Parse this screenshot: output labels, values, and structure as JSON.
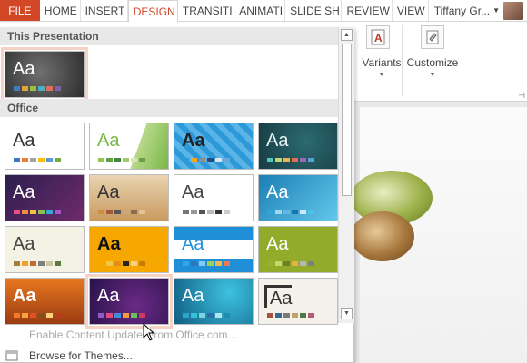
{
  "tabs": [
    {
      "label": "FILE"
    },
    {
      "label": "HOME"
    },
    {
      "label": "INSERT"
    },
    {
      "label": "DESIGN"
    },
    {
      "label": "TRANSITI"
    },
    {
      "label": "ANIMATI"
    },
    {
      "label": "SLIDE SH"
    },
    {
      "label": "REVIEW"
    },
    {
      "label": "VIEW"
    }
  ],
  "user": {
    "name": "Tiffany Gr..."
  },
  "ribbon": {
    "variants_label": "Variants",
    "customize_label": "Customize"
  },
  "gallery": {
    "this_presentation_header": "This Presentation",
    "office_header": "Office",
    "current_theme": {
      "text": "Aa",
      "swatches": [
        "#3f7dc1",
        "#e3a43c",
        "#9ac040",
        "#4bb0c8",
        "#e46c5b",
        "#7e62a8"
      ]
    },
    "themes": [
      {
        "text": "Aa",
        "swatches": [
          "#4472c4",
          "#ed7d31",
          "#a5a5a5",
          "#ffc000",
          "#5b9bd5",
          "#70ad47"
        ]
      },
      {
        "text": "Aa",
        "swatches": [
          "#8fc54c",
          "#62a142",
          "#3f8a38",
          "#a2c86a",
          "#d5e7b7",
          "#6f9f42"
        ]
      },
      {
        "text": "Aa",
        "swatches": [
          "#2a9bd6",
          "#f4a51c",
          "#8e8e8e",
          "#2c4a7a",
          "#e3e3e3",
          "#6ca7d8"
        ]
      },
      {
        "text": "Aa",
        "swatches": [
          "#57c2b5",
          "#b7d96f",
          "#f1b34d",
          "#e26c54",
          "#9a66b8",
          "#59a0d6"
        ]
      },
      {
        "text": "Aa",
        "swatches": [
          "#e84e8a",
          "#f48b3d",
          "#f7c33c",
          "#8bc34a",
          "#38a7dd",
          "#a35ac8"
        ]
      },
      {
        "text": "Aa",
        "swatches": [
          "#d08b3e",
          "#a4573a",
          "#555555",
          "#c9a77a",
          "#8c6b4e",
          "#e0c49b"
        ]
      },
      {
        "text": "Aa",
        "swatches": [
          "#777777",
          "#999999",
          "#555555",
          "#bbbbbb",
          "#333333",
          "#cccccc"
        ]
      },
      {
        "text": "Aa",
        "swatches": [
          "#30a3d7",
          "#9fd8ef",
          "#65b7e1",
          "#1876a9",
          "#c6eaf7",
          "#4fc1e9"
        ]
      },
      {
        "text": "Aa",
        "swatches": [
          "#a67d3d",
          "#f0a22e",
          "#c46a2e",
          "#7e7e7e",
          "#c9c9a0",
          "#5e7b3a"
        ]
      },
      {
        "text": "Aa",
        "swatches": [
          "#f7a600",
          "#f2c744",
          "#e08e14",
          "#252525",
          "#f7d27b",
          "#c77b00"
        ]
      },
      {
        "text": "Aa",
        "swatches": [
          "#30a8e2",
          "#2f75bc",
          "#88c9ee",
          "#9bcf60",
          "#f6b64d",
          "#ea7a54"
        ]
      },
      {
        "text": "Aa",
        "swatches": [
          "#97b12c",
          "#c6d66e",
          "#6a821f",
          "#e3b04b",
          "#b6b6b6",
          "#7f7f7f"
        ]
      },
      {
        "text": "Aa",
        "swatches": [
          "#f17a2a",
          "#f9a13c",
          "#e14f25",
          "#8b4d1e",
          "#ffd27a",
          "#b93c1d"
        ]
      },
      {
        "text": "Aa",
        "swatches": [
          "#8e5bc5",
          "#e04a7f",
          "#3f8ed8",
          "#f39c3d",
          "#6bbf59",
          "#c93a61"
        ]
      },
      {
        "text": "Aa",
        "swatches": [
          "#2ea6c9",
          "#38c1d6",
          "#7ed0e3",
          "#2a6da8",
          "#b3e3ee",
          "#1a8fb0"
        ]
      },
      {
        "text": "Aa",
        "swatches": [
          "#a84f3d",
          "#3a6b8e",
          "#7b7b7b",
          "#c2a26c",
          "#4c7a43",
          "#b45b71"
        ]
      }
    ]
  },
  "menu": {
    "enable_updates": "Enable Content Updates from Office.com...",
    "browse_themes": "Browse for Themes..."
  }
}
